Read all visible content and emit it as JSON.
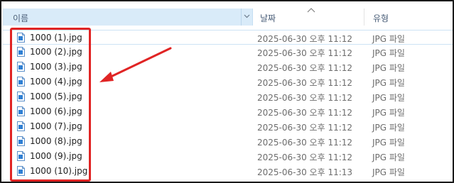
{
  "columns": {
    "name": "이름",
    "date": "날짜",
    "type": "유형"
  },
  "files": [
    {
      "name": "1000 (1).jpg",
      "date": "2025-06-30 오후 11:12",
      "type": "JPG 파일"
    },
    {
      "name": "1000 (2).jpg",
      "date": "2025-06-30 오후 11:12",
      "type": "JPG 파일"
    },
    {
      "name": "1000 (3).jpg",
      "date": "2025-06-30 오후 11:12",
      "type": "JPG 파일"
    },
    {
      "name": "1000 (4).jpg",
      "date": "2025-06-30 오후 11:12",
      "type": "JPG 파일"
    },
    {
      "name": "1000 (5).jpg",
      "date": "2025-06-30 오후 11:12",
      "type": "JPG 파일"
    },
    {
      "name": "1000 (6).jpg",
      "date": "2025-06-30 오후 11:12",
      "type": "JPG 파일"
    },
    {
      "name": "1000 (7).jpg",
      "date": "2025-06-30 오후 11:12",
      "type": "JPG 파일"
    },
    {
      "name": "1000 (8).jpg",
      "date": "2025-06-30 오후 11:12",
      "type": "JPG 파일"
    },
    {
      "name": "1000 (9).jpg",
      "date": "2025-06-30 오후 11:12",
      "type": "JPG 파일"
    },
    {
      "name": "1000 (10).jpg",
      "date": "2025-06-30 오후 11:13",
      "type": "JPG 파일"
    }
  ],
  "icons": {
    "file": "jpg-file-icon",
    "sort": "sort-caret-icon",
    "dropdown": "chevron-down-icon"
  },
  "colors": {
    "annotation": "#e02424",
    "header_bg": "#d9ebf9",
    "icon_blue": "#2f7fd3"
  }
}
